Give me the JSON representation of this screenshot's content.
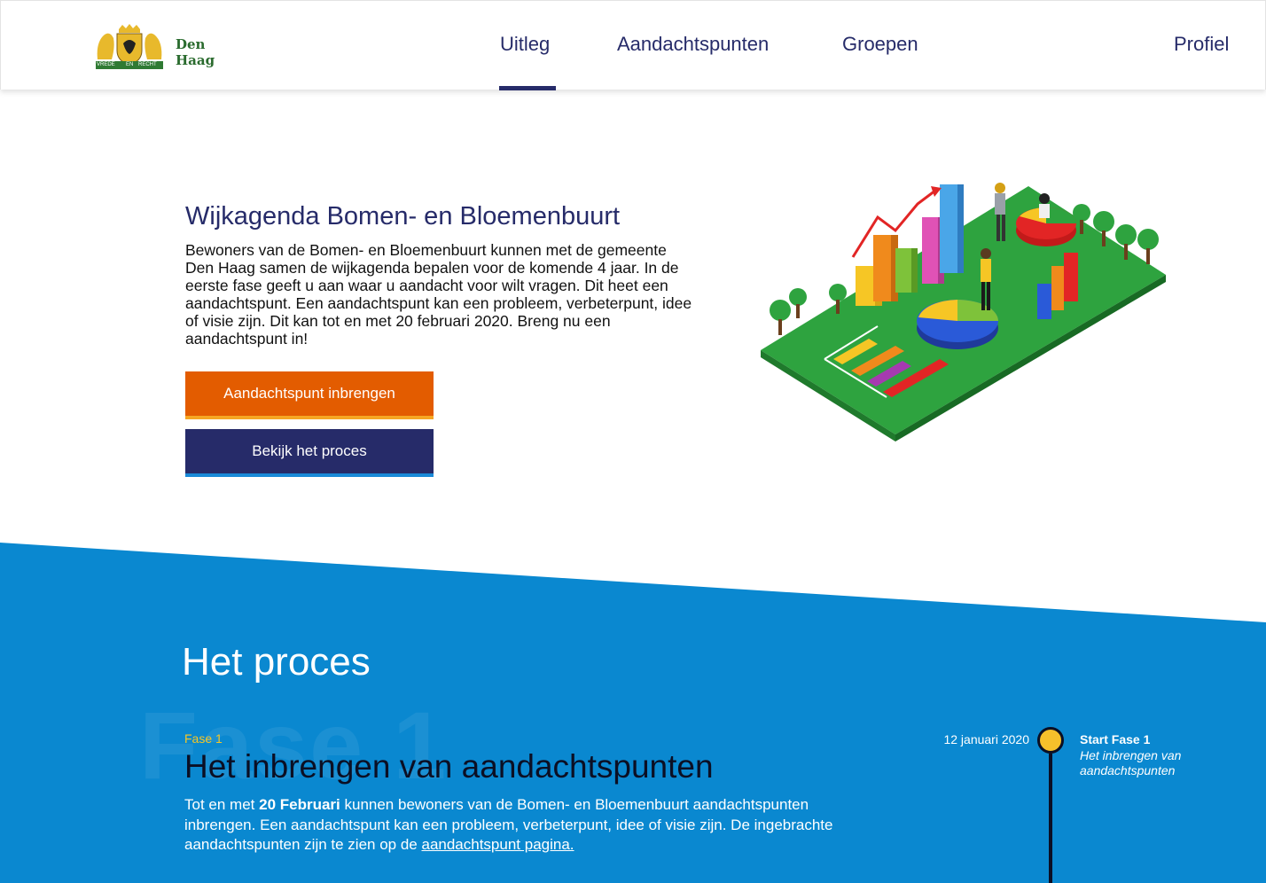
{
  "header": {
    "logo_text": "Den Haag",
    "logo_motto_left": "VREDE",
    "logo_motto_mid": "EN",
    "logo_motto_right": "RECHT",
    "nav": [
      {
        "label": "Uitleg",
        "active": true
      },
      {
        "label": "Aandachtspunten",
        "active": false
      },
      {
        "label": "Groepen",
        "active": false
      },
      {
        "label": "Profiel",
        "active": false
      }
    ]
  },
  "hero": {
    "title": "Wijkagenda Bomen- en Bloemenbuurt",
    "text": "Bewoners van de Bomen- en Bloemenbuurt kunnen met de gemeente Den Haag samen de wijkagenda bepalen voor de komende 4 jaar. In de eerste fase geeft u aan waar u aandacht voor wilt vragen. Dit heet een aandachtspunt. Een aandachtspunt kan een probleem, verbeterpunt, idee of visie zijn. Dit kan tot en met 20 februari 2020. Breng nu een aandachtspunt in!",
    "primary_button": "Aandachtspunt inbrengen",
    "secondary_button": "Bekijk het proces"
  },
  "proces": {
    "title": "Het proces",
    "watermark": "Fase 1",
    "fase_label": "Fase 1",
    "fase_title": "Het inbrengen van aandachtspunten",
    "text_before": "Tot en met ",
    "text_bold": "20 Februari",
    "text_after": " kunnen bewoners van de Bomen- en Bloemenbuurt aandachtspunten inbrengen. Een aandachtspunt kan een probleem, verbeterpunt, idee of visie zijn. De ingebrachte aandachtspunten zijn te zien op de ",
    "link_text": "aandachtspunt pagina."
  },
  "timeline": {
    "date": "12 januari 2020",
    "title": "Start Fase 1",
    "subtitle": "Het inbrengen van aandachtspunten"
  },
  "colors": {
    "navy": "#262b69",
    "orange": "#e35c00",
    "blue": "#0a88d0",
    "yellow": "#f6c02b"
  }
}
